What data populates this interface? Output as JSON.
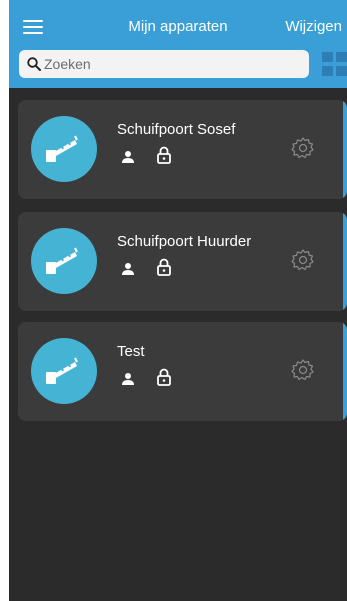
{
  "header": {
    "title": "Mijn apparaten",
    "edit_label": "Wijzigen",
    "menu_icon": "hamburger-menu-icon",
    "grid_icon": "grid-view-icon",
    "accent_color": "#3a9fd6"
  },
  "search": {
    "placeholder": "Zoeken",
    "value": "",
    "icon": "search-icon"
  },
  "devices": [
    {
      "name": "Schuifpoort Sosef",
      "icons": [
        "gate-barrier-icon",
        "user-icon",
        "lock-icon",
        "gear-icon"
      ]
    },
    {
      "name": "Schuifpoort Huurder",
      "icons": [
        "gate-barrier-icon",
        "user-icon",
        "lock-icon",
        "gear-icon"
      ]
    },
    {
      "name": "Test",
      "icons": [
        "gate-barrier-icon",
        "user-icon",
        "lock-icon",
        "gear-icon"
      ]
    }
  ],
  "colors": {
    "background": "#2b2b2b",
    "card": "#3b3b3b",
    "avatar": "#45b3d3",
    "gear": "#8a8a8a"
  }
}
